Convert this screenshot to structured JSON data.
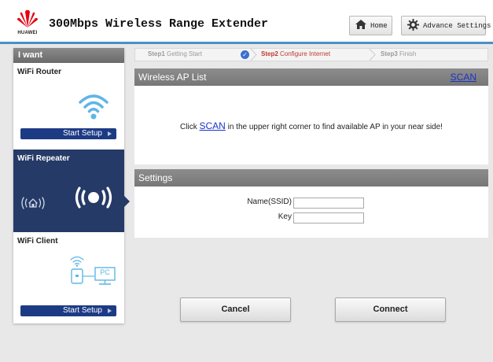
{
  "header": {
    "logo_text": "HUAWEI",
    "title": "300Mbps Wireless Range Extender",
    "home_label": "Home",
    "advance_label": "Advance Settings"
  },
  "sidebar": {
    "heading": "I want",
    "modes": [
      {
        "label": "WiFi Router",
        "button": "Start Setup",
        "selected": false
      },
      {
        "label": "WiFi Repeater",
        "selected": true
      },
      {
        "label": "WiFi Client",
        "button": "Start Setup",
        "selected": false,
        "pc_label": "PC"
      }
    ]
  },
  "steps": [
    {
      "num": "Step1",
      "label": "Getting Start",
      "state": "done"
    },
    {
      "num": "Step2",
      "label": "Configure Internet",
      "state": "active"
    },
    {
      "num": "Step3",
      "label": "Finish",
      "state": "pending"
    }
  ],
  "ap_list": {
    "title": "Wireless AP List",
    "scan_label": "SCAN",
    "message_before": "Click",
    "message_link": "SCAN",
    "message_after": "in the upper right corner to find available AP in your near side!"
  },
  "settings": {
    "title": "Settings",
    "ssid_label": "Name(SSID)",
    "ssid_value": "",
    "key_label": "Key",
    "key_value": ""
  },
  "actions": {
    "cancel_label": "Cancel",
    "connect_label": "Connect"
  },
  "colors": {
    "accent": "#4a90c8",
    "selected_mode_bg": "#253a66",
    "start_button": "#1d3b85",
    "active_step": "#c0392b",
    "link": "#1a35c8",
    "brand_red": "#e60012"
  },
  "icons": [
    "huawei-logo",
    "home-icon",
    "gear-icon",
    "wifi-icon",
    "repeater-wave-icon",
    "house-wave-icon",
    "client-device-icon",
    "pc-icon",
    "check-icon"
  ]
}
